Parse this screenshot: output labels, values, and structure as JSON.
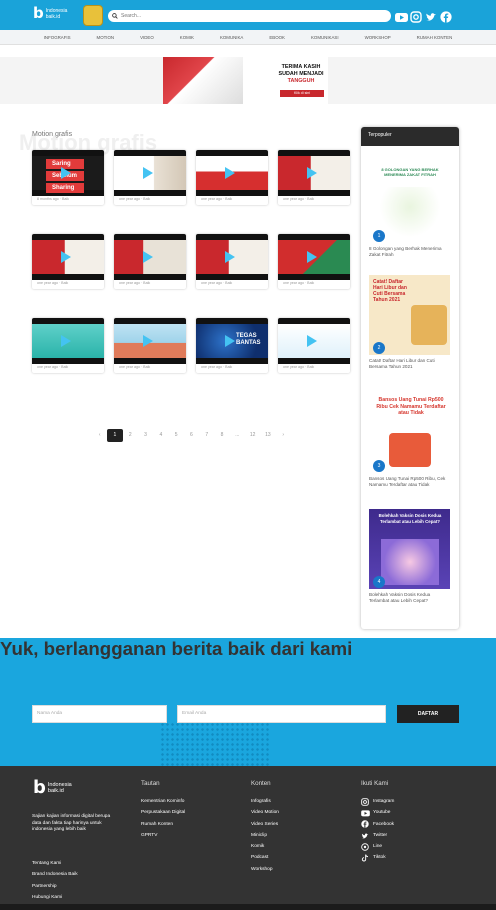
{
  "header": {
    "logo_text": "Indonesia baik.id",
    "search_placeholder": "Search..."
  },
  "menu": [
    "INFOGRAFIS",
    "MOTION",
    "VIDEO",
    "KOMIK",
    "KOMUNIKA",
    "EBOOK",
    "KOMUNIKASI",
    "WORKSHOP",
    "RUMAH KONTEN"
  ],
  "ad": {
    "line1": "TERIMA KASIH",
    "line2": "SUDAH MENJADI",
    "line3": "TANGGUH",
    "cta": "Klik di sini"
  },
  "section": {
    "title": "Motion grafis",
    "ghost": "Motion grafis"
  },
  "videos": [
    {
      "meta": "8 months ago · Baik",
      "thumb": "Saring Sebelum Sharing"
    },
    {
      "meta": "one year ago · Baik"
    },
    {
      "meta": "one year ago · Baik"
    },
    {
      "meta": "one year ago · Baik"
    },
    {
      "meta": "one year ago · Baik"
    },
    {
      "meta": "one year ago · Baik"
    },
    {
      "meta": "one year ago · Baik"
    },
    {
      "meta": "one year ago · Baik"
    },
    {
      "meta": "one year ago · Baik"
    },
    {
      "meta": "one year ago · Baik"
    },
    {
      "meta": "one year ago · Baik",
      "thumb": "TEGAS BANTAS"
    },
    {
      "meta": "one year ago · Baik"
    }
  ],
  "pagination": [
    "‹",
    "1",
    "2",
    "3",
    "4",
    "5",
    "6",
    "7",
    "8",
    "...",
    "12",
    "13",
    "›"
  ],
  "sidebar": {
    "title": "Terpopuler",
    "items": [
      {
        "num": "1",
        "caption": "8 Golongan yang Berhak Menerima Zakat Fitrah",
        "heading": "8 GOLONGAN YANG BERHAK MENERIMA ZAKAT FITRAH"
      },
      {
        "num": "2",
        "caption": "Catat! Daftar Hari Libur dan Cuti Bersama Tahun 2021",
        "heading": "Catat! Daftar Hari Libur dan Cuti Bersama Tahun 2021"
      },
      {
        "num": "3",
        "caption": "Bansos Uang Tunai Rp500 Ribu, Cek Namamu Terdaftar atau Tidak",
        "heading": "Bansos Uang Tunai Rp500 Ribu Cek Namamu Terdaftar atau Tidak"
      },
      {
        "num": "4",
        "caption": "Bolehkah Vaksin Dosis Kedua Terlambat atau Lebih Cepat?",
        "heading": "Bolehkah Vaksin Dosis Kedua Terlambat atau Lebih Cepat?"
      }
    ]
  },
  "subscribe": {
    "title": "Yuk, berlangganan berita baik dari kami",
    "name_placeholder": "Nama Anda",
    "email_placeholder": "Email Anda",
    "button": "DAFTAR"
  },
  "footer": {
    "logo_text": "Indonesia baik.id",
    "desc": "Sajian kajian informasi digital berupa data dan fakta tiap harinya untuk indonesia yang lebih baik",
    "links": [
      "Tentang Kami",
      "Brand Indonesia Baik",
      "Partnership",
      "Hubungi Kami"
    ],
    "tautan": {
      "title": "Tautan",
      "items": [
        "Kementrian Kominfo",
        "Perpustakaan Digital",
        "Rumah Konten",
        "GPRTV"
      ]
    },
    "konten": {
      "title": "Konten",
      "items": [
        "Infografis",
        "Video Motion",
        "Video Series",
        "Miniclip",
        "Komik",
        "Podcast",
        "Workshop"
      ]
    },
    "ikuti": {
      "title": "Ikuti Kami",
      "items": [
        "Instagram",
        "Youtube",
        "Facebook",
        "Twitter",
        "Line",
        "Tiktok"
      ]
    }
  },
  "colors": {
    "brand": "#1aa3d9",
    "dark": "#333333",
    "accent": "#c8282d"
  }
}
